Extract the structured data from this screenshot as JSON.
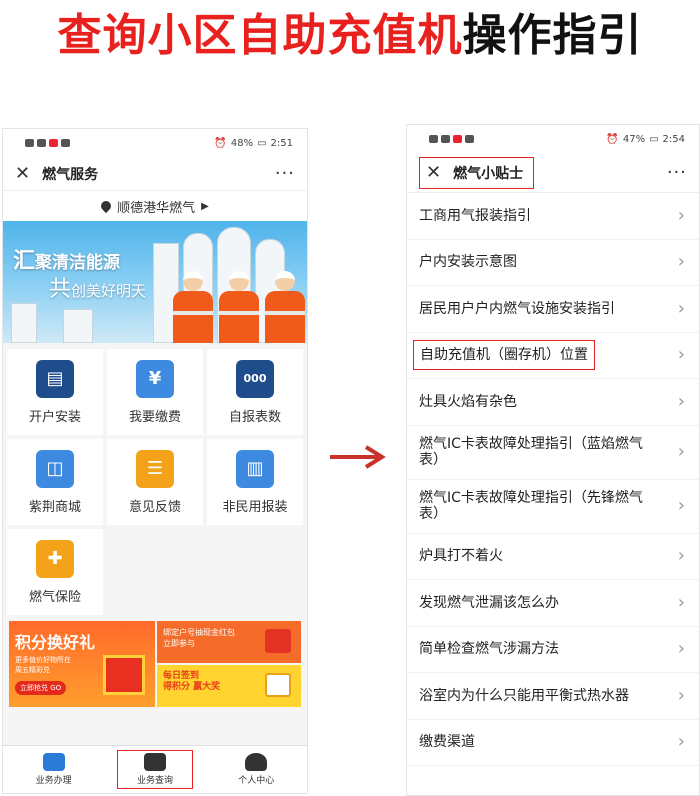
{
  "headline": {
    "part_red": "查询小区自助充值机",
    "part_black": "操作指引"
  },
  "left_phone": {
    "status": {
      "battery": "48%",
      "time": "2:51"
    },
    "nav": {
      "title": "燃气服务",
      "more": "···"
    },
    "location": "顺德港华燃气",
    "banner": {
      "line1_big": "汇",
      "line1": "聚清洁能源",
      "line2_big": "共",
      "line2": "创美好明天"
    },
    "services": [
      {
        "label": "开户安装",
        "icon": "house-doc-icon",
        "color": "navy",
        "glyph": "▤"
      },
      {
        "label": "我要缴费",
        "icon": "yuan-icon",
        "color": "blue",
        "glyph": "¥"
      },
      {
        "label": "自报表数",
        "icon": "meter-icon",
        "color": "navy",
        "glyph": "000"
      },
      {
        "label": "紫荆商城",
        "icon": "shopping-bag-icon",
        "color": "blue",
        "glyph": "◫"
      },
      {
        "label": "意见反馈",
        "icon": "chat-bubble-icon",
        "color": "orange",
        "glyph": "☰"
      },
      {
        "label": "非民用报装",
        "icon": "building-icon",
        "color": "blue",
        "glyph": "▥"
      },
      {
        "label": "燃气保险",
        "icon": "shield-plus-icon",
        "color": "orange",
        "glyph": "✚"
      }
    ],
    "promos": {
      "big_title": "积分换好礼",
      "big_sub": "更多值价好物所在\n周五精彩兑",
      "big_btn": "立即抢兑 GO",
      "small_a": "绑定户号抽现金红包\n立即参与",
      "small_b": "每日签到\n得积分 赢大奖"
    },
    "tabs": [
      {
        "label": "业务办理",
        "icon": "toolbox-icon",
        "style": "blue",
        "highlight": false
      },
      {
        "label": "业务查询",
        "icon": "search-doc-icon",
        "style": "dark",
        "highlight": true
      },
      {
        "label": "个人中心",
        "icon": "person-icon",
        "style": "gray",
        "highlight": false
      }
    ]
  },
  "right_phone": {
    "status": {
      "battery": "47%",
      "time": "2:54"
    },
    "nav": {
      "title": "燃气小贴士",
      "more": "···"
    },
    "items": [
      {
        "label": "工商用气报装指引",
        "highlight": false
      },
      {
        "label": "户内安装示意图",
        "highlight": false
      },
      {
        "label": "居民用户户内燃气设施安装指引",
        "highlight": false
      },
      {
        "label": "自助充值机（圈存机）位置",
        "highlight": true
      },
      {
        "label": "灶具火焰有杂色",
        "highlight": false
      },
      {
        "label": "燃气IC卡表故障处理指引（蓝焰燃气表）",
        "highlight": false
      },
      {
        "label": "燃气IC卡表故障处理指引（先锋燃气表）",
        "highlight": false
      },
      {
        "label": "炉具打不着火",
        "highlight": false
      },
      {
        "label": "发现燃气泄漏该怎么办",
        "highlight": false
      },
      {
        "label": "简单检查燃气涉漏方法",
        "highlight": false
      },
      {
        "label": "浴室内为什么只能用平衡式热水器",
        "highlight": false
      },
      {
        "label": "缴费渠道",
        "highlight": false
      }
    ]
  },
  "colors": {
    "accent_red": "#e8211e",
    "brand_blue": "#3e8ae0",
    "navy": "#1f4d8c",
    "orange": "#f4a21a"
  }
}
